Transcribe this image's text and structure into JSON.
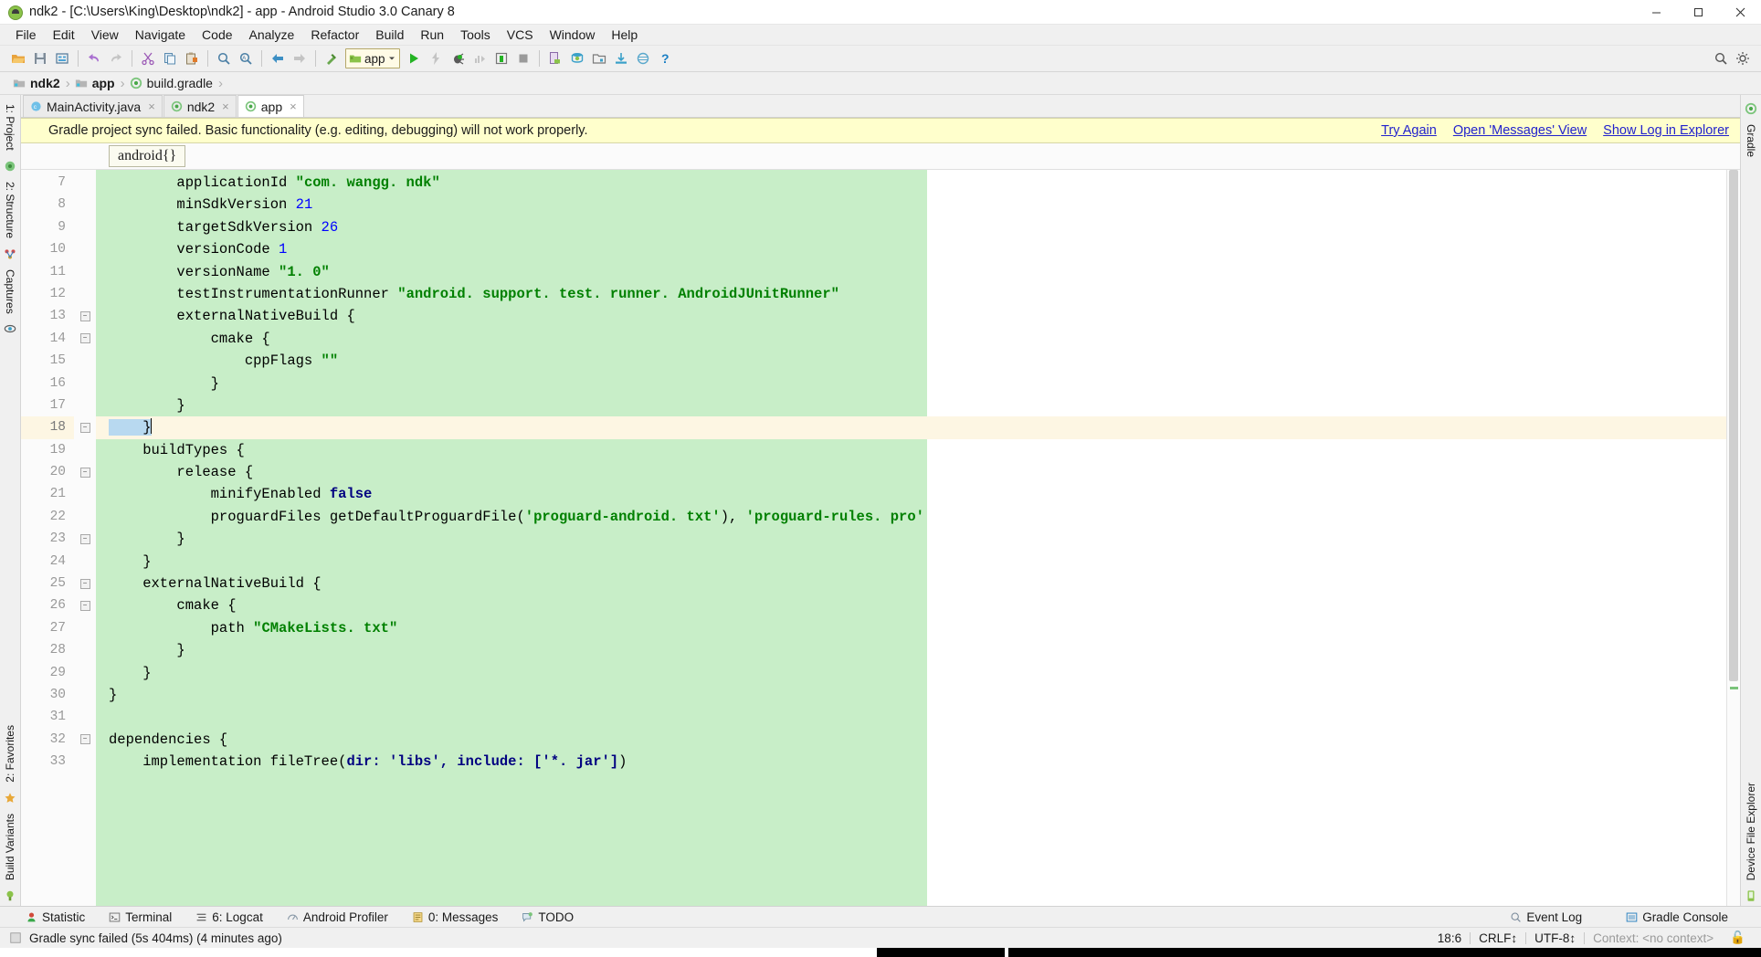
{
  "window": {
    "title": "ndk2 - [C:\\Users\\King\\Desktop\\ndk2] - app - Android Studio 3.0 Canary 8",
    "app_icon": "android-logo-icon",
    "minimize": "minimize-button",
    "maximize": "maximize-button",
    "close": "close-button"
  },
  "menubar": {
    "items": [
      {
        "label": "File"
      },
      {
        "label": "Edit"
      },
      {
        "label": "View"
      },
      {
        "label": "Navigate"
      },
      {
        "label": "Code"
      },
      {
        "label": "Analyze"
      },
      {
        "label": "Refactor"
      },
      {
        "label": "Build"
      },
      {
        "label": "Run"
      },
      {
        "label": "Tools"
      },
      {
        "label": "VCS"
      },
      {
        "label": "Window"
      },
      {
        "label": "Help"
      }
    ]
  },
  "toolbar": {
    "icons": [
      "open-folder-icon",
      "save-all-icon",
      "sync-icon",
      "undo-icon",
      "redo-icon",
      "cut-icon",
      "copy-icon",
      "paste-icon",
      "find-icon",
      "replace-icon",
      "back-icon",
      "forward-icon",
      "build-hammer-icon"
    ],
    "run_config": {
      "label": "app",
      "icon": "module-icon",
      "dropdown": "chevron-down-icon"
    },
    "action_icons": [
      "run-icon",
      "apply-changes-icon",
      "debug-icon",
      "profile-icon",
      "attach-debugger-icon",
      "stop-icon"
    ],
    "right_icons": [
      "avd-manager-icon",
      "sdk-manager-icon",
      "project-structure-icon",
      "sync-gradle-icon",
      "search-everywhere-icon",
      "help-icon"
    ],
    "far_right_icons": [
      "search-icon",
      "settings-icon"
    ]
  },
  "breadcrumb": {
    "items": [
      {
        "label": "ndk2",
        "icon": "module-folder-icon"
      },
      {
        "label": "app",
        "icon": "module-folder-icon"
      },
      {
        "label": "build.gradle",
        "icon": "gradle-file-icon"
      }
    ],
    "separator": "›"
  },
  "tabs": [
    {
      "label": "MainActivity.java",
      "icon": "java-class-icon",
      "active": false,
      "close": "×"
    },
    {
      "label": "ndk2",
      "icon": "gradle-file-icon",
      "active": false,
      "close": "×"
    },
    {
      "label": "app",
      "icon": "gradle-file-icon",
      "active": true,
      "close": "×"
    }
  ],
  "notification": {
    "message": "Gradle project sync failed. Basic functionality (e.g. editing, debugging) will not work properly.",
    "links": [
      "Try Again",
      "Open 'Messages' View",
      "Show Log in Explorer"
    ]
  },
  "structure_crumb": {
    "label": "android{}"
  },
  "left_tools": [
    {
      "label": "1: Project",
      "icon": "project-icon"
    },
    {
      "label": "2: Structure",
      "icon": "structure-icon"
    },
    {
      "label": "Captures",
      "icon": "captures-icon"
    }
  ],
  "left_tools_bottom": [
    {
      "label": "2: Favorites",
      "icon": "favorites-star-icon"
    },
    {
      "label": "Build Variants",
      "icon": "build-variants-icon"
    }
  ],
  "right_tools": [
    {
      "label": "Gradle",
      "icon": "gradle-icon"
    }
  ],
  "right_tools_bottom": [
    {
      "label": "Device File Explorer",
      "icon": "device-explorer-icon"
    }
  ],
  "editor": {
    "first_line_number": 7,
    "current_line": 18,
    "lines": [
      {
        "n": 7,
        "fold": false,
        "tokens": [
          {
            "t": "        applicationId ",
            "c": "pl"
          },
          {
            "t": "\"com. wangg. ndk\"",
            "c": "str"
          }
        ]
      },
      {
        "n": 8,
        "fold": false,
        "tokens": [
          {
            "t": "        minSdkVersion ",
            "c": "pl"
          },
          {
            "t": "21",
            "c": "num"
          }
        ]
      },
      {
        "n": 9,
        "fold": false,
        "tokens": [
          {
            "t": "        targetSdkVersion ",
            "c": "pl"
          },
          {
            "t": "26",
            "c": "num"
          }
        ]
      },
      {
        "n": 10,
        "fold": false,
        "tokens": [
          {
            "t": "        versionCode ",
            "c": "pl"
          },
          {
            "t": "1",
            "c": "num"
          }
        ]
      },
      {
        "n": 11,
        "fold": false,
        "tokens": [
          {
            "t": "        versionName ",
            "c": "pl"
          },
          {
            "t": "\"1. 0\"",
            "c": "str"
          }
        ]
      },
      {
        "n": 12,
        "fold": false,
        "tokens": [
          {
            "t": "        testInstrumentationRunner ",
            "c": "pl"
          },
          {
            "t": "\"android. support. test. runner. AndroidJUnitRunner\"",
            "c": "str"
          }
        ]
      },
      {
        "n": 13,
        "fold": true,
        "tokens": [
          {
            "t": "        externalNativeBuild {",
            "c": "pl"
          }
        ]
      },
      {
        "n": 14,
        "fold": true,
        "tokens": [
          {
            "t": "            cmake {",
            "c": "pl"
          }
        ]
      },
      {
        "n": 15,
        "fold": false,
        "tokens": [
          {
            "t": "                cppFlags ",
            "c": "pl"
          },
          {
            "t": "\"\"",
            "c": "str"
          }
        ]
      },
      {
        "n": 16,
        "fold": false,
        "tokens": [
          {
            "t": "            }",
            "c": "pl"
          }
        ]
      },
      {
        "n": 17,
        "fold": false,
        "tokens": [
          {
            "t": "        }",
            "c": "pl"
          }
        ]
      },
      {
        "n": 18,
        "fold": true,
        "tokens": [
          {
            "t": "    }",
            "c": "sel"
          }
        ]
      },
      {
        "n": 19,
        "fold": false,
        "tokens": [
          {
            "t": "    buildTypes {",
            "c": "pl"
          }
        ]
      },
      {
        "n": 20,
        "fold": true,
        "tokens": [
          {
            "t": "        release {",
            "c": "pl"
          }
        ]
      },
      {
        "n": 21,
        "fold": false,
        "tokens": [
          {
            "t": "            minifyEnabled ",
            "c": "pl"
          },
          {
            "t": "false",
            "c": "kw"
          }
        ]
      },
      {
        "n": 22,
        "fold": false,
        "tokens": [
          {
            "t": "            proguardFiles getDefaultProguardFile(",
            "c": "pl"
          },
          {
            "t": "'proguard-android. txt'",
            "c": "str"
          },
          {
            "t": "), ",
            "c": "pl"
          },
          {
            "t": "'proguard-rules. pro'",
            "c": "str"
          }
        ]
      },
      {
        "n": 23,
        "fold": true,
        "tokens": [
          {
            "t": "        }",
            "c": "pl"
          }
        ]
      },
      {
        "n": 24,
        "fold": false,
        "tokens": [
          {
            "t": "    }",
            "c": "pl"
          }
        ]
      },
      {
        "n": 25,
        "fold": true,
        "tokens": [
          {
            "t": "    externalNativeBuild {",
            "c": "pl"
          }
        ]
      },
      {
        "n": 26,
        "fold": true,
        "tokens": [
          {
            "t": "        cmake {",
            "c": "pl"
          }
        ]
      },
      {
        "n": 27,
        "fold": false,
        "tokens": [
          {
            "t": "            path ",
            "c": "pl"
          },
          {
            "t": "\"CMakeLists. txt\"",
            "c": "str"
          }
        ]
      },
      {
        "n": 28,
        "fold": false,
        "tokens": [
          {
            "t": "        }",
            "c": "pl"
          }
        ]
      },
      {
        "n": 29,
        "fold": false,
        "tokens": [
          {
            "t": "    }",
            "c": "pl"
          }
        ]
      },
      {
        "n": 30,
        "fold": false,
        "tokens": [
          {
            "t": "}",
            "c": "pl"
          }
        ]
      },
      {
        "n": 31,
        "fold": false,
        "tokens": [
          {
            "t": "",
            "c": "pl"
          }
        ]
      },
      {
        "n": 32,
        "fold": true,
        "tokens": [
          {
            "t": "dependencies {",
            "c": "pl"
          }
        ]
      },
      {
        "n": 33,
        "fold": false,
        "tokens": [
          {
            "t": "    implementation fileTree(",
            "c": "pl"
          },
          {
            "t": "dir: 'libs', include: ['*. jar']",
            "c": "kw"
          },
          {
            "t": ")",
            "c": "pl"
          }
        ]
      }
    ]
  },
  "bottom_tools": [
    {
      "label": "Statistic",
      "icon": "statistic-icon",
      "mnemonic": ""
    },
    {
      "label": "Terminal",
      "icon": "terminal-icon",
      "mnemonic": ""
    },
    {
      "label": "6: Logcat",
      "icon": "logcat-icon",
      "mnemonic": "6"
    },
    {
      "label": "Android Profiler",
      "icon": "profiler-icon",
      "mnemonic": ""
    },
    {
      "label": "0: Messages",
      "icon": "messages-icon",
      "mnemonic": "0"
    },
    {
      "label": "TODO",
      "icon": "todo-icon",
      "mnemonic": ""
    }
  ],
  "bottom_tools_right": [
    {
      "label": "Event Log",
      "icon": "event-log-icon"
    },
    {
      "label": "Gradle Console",
      "icon": "gradle-console-icon"
    }
  ],
  "statusbar": {
    "message": "Gradle sync failed (5s 404ms) (4 minutes ago)",
    "icon": "status-square-icon",
    "caret": "18:6",
    "line_separator": "CRLF↕",
    "encoding": "UTF-8↕",
    "context": "Context: <no context>",
    "lock": "🔓"
  },
  "colors": {
    "accent_green": "#c8eec8",
    "notification_bg": "#ffffcc",
    "link": "#2222cc",
    "string": "#008000",
    "number": "#0000ff",
    "keyword": "#000080",
    "current_line": "#fdf6e3"
  }
}
